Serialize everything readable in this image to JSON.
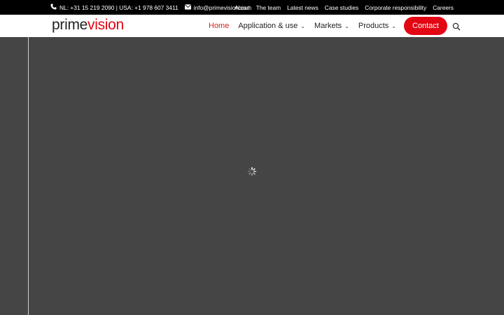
{
  "topbar": {
    "phone_icon": "phone-icon",
    "phone_text": "NL: +31 15 219 2090 | USA: +1 978 607 3411",
    "email_icon": "envelope-icon",
    "email": "info@primevision.com",
    "links": [
      "About",
      "The team",
      "Latest news",
      "Case studies",
      "Corporate responsibility",
      "Careers"
    ]
  },
  "header": {
    "logo_part1": "prime",
    "logo_part2": "vision",
    "nav": {
      "home": "Home",
      "application": "Application & use",
      "markets": "Markets",
      "products": "Products",
      "contact": "Contact"
    },
    "search_icon": "search-icon"
  },
  "colors": {
    "brand_red": "#e30613",
    "active_nav": "#d62121",
    "overlay": "#454545",
    "topbar_bg": "#000000"
  },
  "loader_icon": "loading-spinner-icon"
}
